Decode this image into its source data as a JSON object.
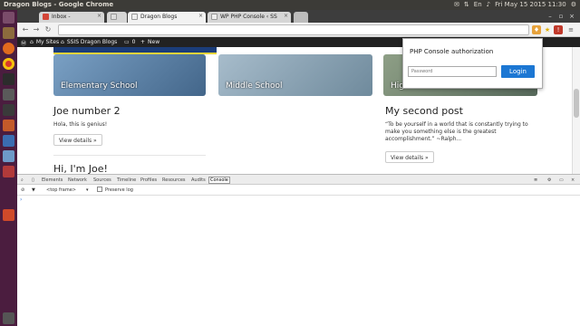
{
  "topbar": {
    "window_title": "Dragon Blogs - Google Chrome",
    "datetime": "Fri May 15 2015 11:30"
  },
  "launcher": {
    "icons": [
      "dash-icon",
      "files-icon",
      "firefox-icon",
      "chrome-icon",
      "terminal-icon",
      "app-icon",
      "settings-icon",
      "text-editor-icon",
      "app-icon-2",
      "app-icon-3",
      "app-icon-4",
      "app-icon-5",
      "trash-icon"
    ]
  },
  "tabs": [
    {
      "label": "Inbox - ",
      "active": false
    },
    {
      "label": "",
      "active": false
    },
    {
      "label": "Dragon Blogs",
      "active": true
    },
    {
      "label": "WP PHP Console ‹ SS",
      "active": false
    }
  ],
  "toolbar": {
    "url": ""
  },
  "wpbar": {
    "my_sites": "My Sites",
    "site_name": "SSIS Dragon Blogs",
    "comments": "0",
    "new": "New"
  },
  "banners": [
    {
      "label": "Elementary School",
      "color": "#5f83a8"
    },
    {
      "label": "Middle School",
      "color": "#8aa4b8"
    },
    {
      "label": "Hig",
      "color": "#6b7f6e"
    }
  ],
  "posts": [
    {
      "title": "Joe number 2",
      "body": "Hola, this is genius!",
      "button": "View details »"
    },
    {
      "title": "My second post",
      "body": "“To be yourself in a world that is constantly trying to make you something else is the greatest accomplishment.” ~Ralph...",
      "button": "View details »"
    },
    {
      "title": "Hi, I'm Joe!"
    }
  ],
  "popup": {
    "title": "PHP Console authorization",
    "placeholder": "Password",
    "button": "Login",
    "button_color": "#1c77d3"
  },
  "devtools": {
    "tabs": [
      "Elements",
      "Network",
      "Sources",
      "Timeline",
      "Profiles",
      "Resources",
      "Audits",
      "Console"
    ],
    "active_tab": "Console",
    "frame": "<top frame>",
    "preserve_log": "Preserve log",
    "prompt": "›"
  }
}
